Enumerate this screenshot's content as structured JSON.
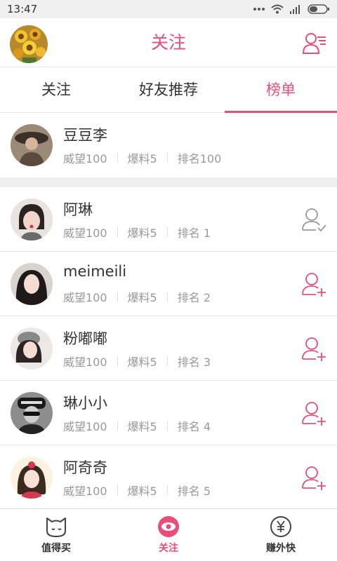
{
  "status_bar": {
    "time": "13:47"
  },
  "header": {
    "title": "关注"
  },
  "tabs": [
    {
      "label": "关注",
      "active": false
    },
    {
      "label": "好友推荐",
      "active": false
    },
    {
      "label": "榜单",
      "active": true
    }
  ],
  "me": {
    "name": "豆豆李",
    "weiwang": "威望100",
    "baoliao": "爆料5",
    "rank": "排名100"
  },
  "users": [
    {
      "name": "阿琳",
      "weiwang": "威望100",
      "baoliao": "爆料5",
      "rank": "排名 1",
      "followed": true
    },
    {
      "name": "meimeili",
      "weiwang": "威望100",
      "baoliao": "爆料5",
      "rank": "排名 2",
      "followed": false
    },
    {
      "name": "粉嘟嘟",
      "weiwang": "威望100",
      "baoliao": "爆料5",
      "rank": "排名 3",
      "followed": false
    },
    {
      "name": "琳小小",
      "weiwang": "威望100",
      "baoliao": "爆料5",
      "rank": "排名 4",
      "followed": false
    },
    {
      "name": "阿奇奇",
      "weiwang": "威望100",
      "baoliao": "爆料5",
      "rank": "排名 5",
      "followed": false
    }
  ],
  "bottom_nav": [
    {
      "label": "值得买",
      "icon": "cat-face-icon",
      "active": false
    },
    {
      "label": "关注",
      "icon": "eye-icon",
      "active": true
    },
    {
      "label": "赚外快",
      "icon": "yuan-coin-icon",
      "active": false
    }
  ],
  "colors": {
    "accent": "#e94e7a",
    "muted": "#999999",
    "divider": "#e6e6e6"
  }
}
